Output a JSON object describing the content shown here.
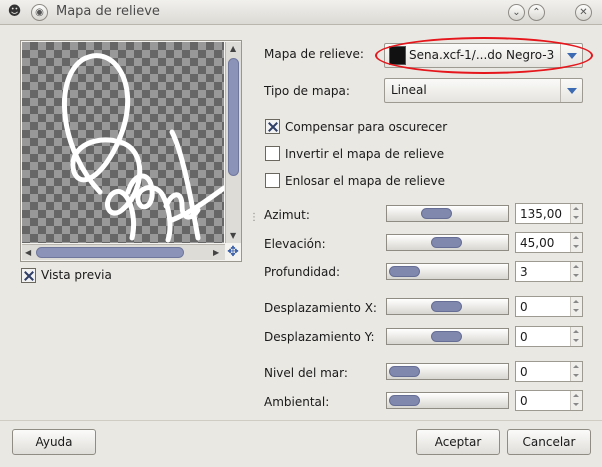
{
  "window": {
    "title": "Mapa de relieve",
    "buttons": {
      "menu": "◉",
      "shade_down": "⌄",
      "shade_up": "⌃",
      "close": "✕"
    }
  },
  "preview": {
    "checkbox_label": "Vista previa",
    "checked": true
  },
  "options": {
    "bump_map_label": "Mapa de relieve:",
    "bump_map_value": "Sena.xcf-1/...do Negro-3",
    "map_type_label": "Tipo de mapa:",
    "map_type_value": "Lineal",
    "compensate_label": "Compensar para oscurecer",
    "compensate_checked": true,
    "invert_label": "Invertir el mapa de relieve",
    "invert_checked": false,
    "tile_label": "Enlosar el mapa de relieve",
    "tile_checked": false
  },
  "sliders": [
    {
      "label": "Azimut:",
      "value": "135,00"
    },
    {
      "label": "Elevación:",
      "value": "45,00"
    },
    {
      "label": "Profundidad:",
      "value": "3"
    },
    {
      "label": "Desplazamiento X:",
      "value": "0"
    },
    {
      "label": "Desplazamiento Y:",
      "value": "0"
    },
    {
      "label": "Nivel del mar:",
      "value": "0"
    },
    {
      "label": "Ambiental:",
      "value": "0"
    }
  ],
  "footer": {
    "help": "Ayuda",
    "accept": "Aceptar",
    "cancel": "Cancelar"
  },
  "colors": {
    "accent": "#8088ad",
    "highlight_ellipse": "#e5161c"
  }
}
